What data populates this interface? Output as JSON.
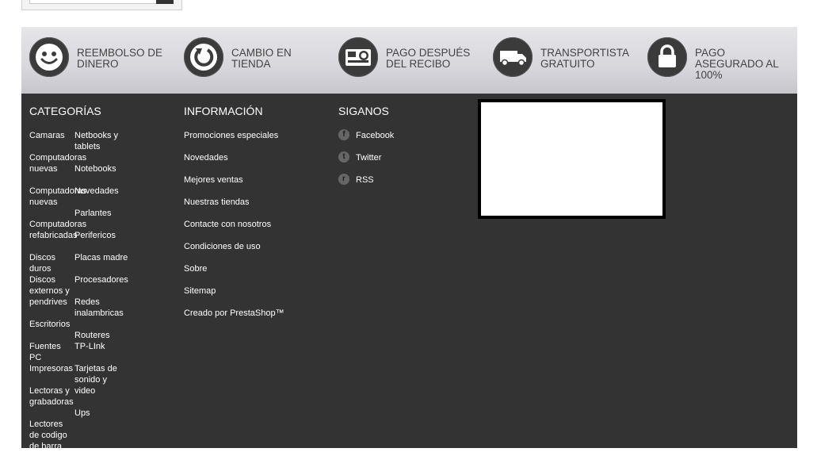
{
  "reassurance": [
    {
      "label": "REEMBOLSO DE DINERO",
      "icon": "smiley-icon"
    },
    {
      "label": "CAMBIO EN TIENDA",
      "icon": "refresh-icon"
    },
    {
      "label": "PAGO DESPUÉS DEL RECIBO",
      "icon": "cash-icon"
    },
    {
      "label": "TRANSPORTISTA GRATUITO",
      "icon": "truck-icon"
    },
    {
      "label": "PAGO ASEGURADO AL 100%",
      "icon": "lock-icon"
    }
  ],
  "categories": {
    "title": "CATEGORÍAS",
    "left": [
      "Camaras",
      "Computadoras nuevas",
      "Computadoras nuevas",
      "Computadoras refabricadas",
      "Discos duros",
      "Discos externos y pendrives",
      "Escritorios",
      "Fuentes PC",
      "Impresoras",
      "Lectoras y grabadoras",
      "Lectores de codigo de barra"
    ],
    "right": [
      "Netbooks y tablets",
      "Notebooks",
      "Novedades",
      "Parlantes",
      "Perifericos",
      "Placas madre",
      "Procesadores",
      "Redes inalambricas",
      "Routeres TP-LInk",
      "Tarjetas de sonido y video",
      "Ups"
    ]
  },
  "info": {
    "title": "INFORMACIÓN",
    "links": [
      "Promociones especiales",
      "Novedades",
      "Mejores ventas",
      "Nuestras tiendas",
      "Contacte con nosotros",
      "Condiciones de uso",
      "Sobre",
      "Sitemap",
      "Creado por PrestaShop™"
    ]
  },
  "social": {
    "title": "SIGANOS",
    "links": [
      {
        "label": "Facebook",
        "glyph": "f"
      },
      {
        "label": "Twitter",
        "glyph": "t"
      },
      {
        "label": "RSS",
        "glyph": "r"
      }
    ]
  }
}
